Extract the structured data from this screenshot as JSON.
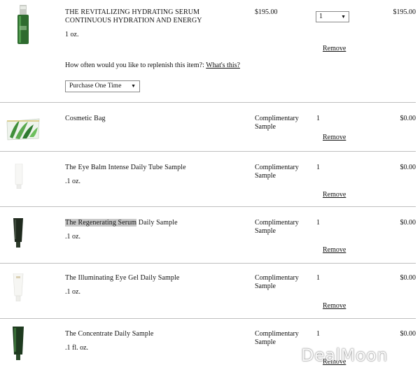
{
  "items": [
    {
      "name_line1": "THE REVITALIZING HYDRATING SERUM",
      "name_line2": "CONTINUOUS HYDRATION AND ENERGY",
      "size": "1 oz.",
      "price": "$195.00",
      "qty": "1",
      "total": "$195.00",
      "remove_label": "Remove",
      "frequency_question": "How often would you like to replenish this item?:",
      "frequency_link": "What's this?",
      "frequency_value": "Purchase One Time",
      "image": "serum-bottle-icon"
    },
    {
      "name": "Cosmetic Bag",
      "price_line1": "Complimentary",
      "price_line2": "Sample",
      "qty": "1",
      "total": "$0.00",
      "remove_label": "Remove",
      "image": "cosmetic-bag-icon"
    },
    {
      "name": "The Eye Balm Intense Daily Tube Sample",
      "size": ".1 oz.",
      "price_line1": "Complimentary",
      "price_line2": "Sample",
      "qty": "1",
      "total": "$0.00",
      "remove_label": "Remove",
      "image": "white-tube-icon"
    },
    {
      "name_highlight": "The Regenerating Serum",
      "name_rest": " Daily Sample",
      "size": ".1 oz.",
      "price_line1": "Complimentary",
      "price_line2": "Sample",
      "qty": "1",
      "total": "$0.00",
      "remove_label": "Remove",
      "image": "dark-tube-icon"
    },
    {
      "name": "The Illuminating Eye Gel Daily Sample",
      "size": ".1 oz.",
      "price_line1": "Complimentary",
      "price_line2": "Sample",
      "qty": "1",
      "total": "$0.00",
      "remove_label": "Remove",
      "image": "white-tube-icon"
    },
    {
      "name": "The Concentrate Daily Sample",
      "size": ".1 fl. oz.",
      "price_line1": "Complimentary",
      "price_line2": "Sample",
      "qty": "1",
      "total": "$0.00",
      "remove_label": "Remove",
      "image": "green-tube-icon"
    }
  ],
  "watermark": "DealMoon",
  "colors": {
    "divider": "#bfbfbf",
    "serum_green": "#2e6b2f",
    "dark_tube": "#1f2a1e"
  }
}
